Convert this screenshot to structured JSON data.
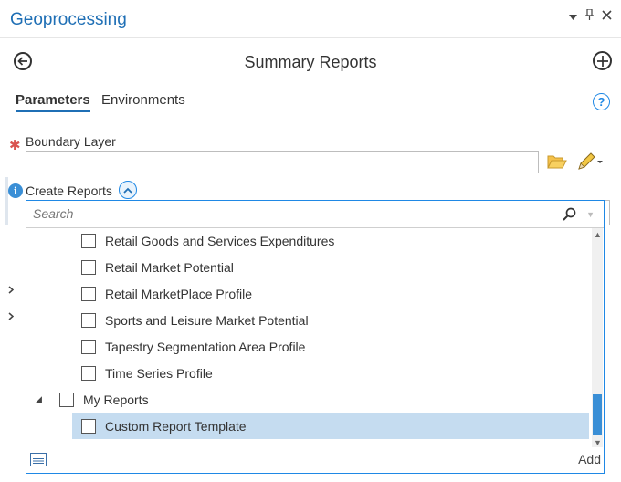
{
  "pane": {
    "title": "Geoprocessing",
    "controls": [
      "chevron-down-icon",
      "pin-icon",
      "close-icon"
    ]
  },
  "tool": {
    "title": "Summary Reports",
    "back_icon": "back-arrow-icon",
    "add_icon": "add-circle-icon"
  },
  "tabs": [
    {
      "label": "Parameters",
      "active": true
    },
    {
      "label": "Environments",
      "active": false
    }
  ],
  "help_icon": "?",
  "params": {
    "boundary_layer": {
      "label": "Boundary Layer",
      "required": true,
      "value": ""
    },
    "create_reports": {
      "label": "Create Reports",
      "info": "i"
    }
  },
  "dropdown": {
    "search_placeholder": "Search",
    "items": [
      {
        "label": "Retail Goods and Services Expenditures",
        "level": 1,
        "checked": false
      },
      {
        "label": "Retail Market Potential",
        "level": 1,
        "checked": false
      },
      {
        "label": "Retail MarketPlace Profile",
        "level": 1,
        "checked": false
      },
      {
        "label": "Sports and Leisure Market Potential",
        "level": 1,
        "checked": false
      },
      {
        "label": "Tapestry Segmentation Area Profile",
        "level": 1,
        "checked": false
      },
      {
        "label": "Time Series Profile",
        "level": 1,
        "checked": false
      },
      {
        "label": "My Reports",
        "level": 0,
        "checked": false,
        "expanded": true
      },
      {
        "label": "Custom Report Template",
        "level": 1,
        "checked": false,
        "selected": true
      }
    ],
    "add_label": "Add"
  },
  "colors": {
    "accent": "#1f6fb5",
    "selection": "#c5dcf0",
    "required": "#d9534f"
  }
}
